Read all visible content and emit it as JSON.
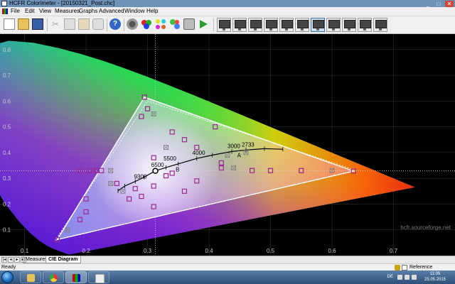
{
  "window": {
    "title": "HCFR Colorimeter - [20150321_Post.chc]",
    "controls": [
      "_",
      "□",
      "✕"
    ]
  },
  "menu": {
    "items": [
      "File",
      "Edit",
      "View",
      "Measures",
      "Graphs",
      "Advanced",
      "Window",
      "Help"
    ]
  },
  "toolbar": {
    "icons": [
      "new-icon",
      "open-icon",
      "save-icon",
      "cut-icon",
      "copy-icon",
      "paste-icon",
      "print-icon",
      "help-icon",
      "probe-icon",
      "rgb-icon",
      "measure-colors-icon",
      "calibration-icon",
      "camera-icon",
      "play-icon"
    ],
    "view_buttons": 11,
    "active_view_index": 6
  },
  "chart_data": {
    "type": "scatter",
    "title": "",
    "watermark": "hcfr.sourceforge.net",
    "xlim": [
      0.06,
      0.8
    ],
    "ylim": [
      0.0,
      0.86
    ],
    "x_ticks": [
      "0.1",
      "0.2",
      "0.3",
      "0.4",
      "0.5",
      "0.6",
      "0.7"
    ],
    "y_ticks": [
      "0.1",
      "0.2",
      "0.3",
      "0.4",
      "0.5",
      "0.6",
      "0.7",
      "0.8"
    ],
    "x_tick_values": [
      0.1,
      0.2,
      0.3,
      0.4,
      0.5,
      0.6,
      0.7
    ],
    "y_tick_values": [
      0.1,
      0.2,
      0.3,
      0.4,
      0.5,
      0.6,
      0.7,
      0.8
    ],
    "gamut_reference": [
      [
        0.64,
        0.33
      ],
      [
        0.3,
        0.6
      ],
      [
        0.15,
        0.06
      ]
    ],
    "gamut_measured": [
      [
        0.635,
        0.328
      ],
      [
        0.295,
        0.615
      ],
      [
        0.153,
        0.062
      ]
    ],
    "white_point": [
      0.3127,
      0.329
    ],
    "planckian_locus": [
      [
        0.252,
        0.252
      ],
      [
        0.263,
        0.27
      ],
      [
        0.28,
        0.288
      ],
      [
        0.294,
        0.304
      ],
      [
        0.3127,
        0.329
      ],
      [
        0.33,
        0.342
      ],
      [
        0.35,
        0.356
      ],
      [
        0.38,
        0.377
      ],
      [
        0.405,
        0.39
      ],
      [
        0.437,
        0.404
      ],
      [
        0.46,
        0.41
      ],
      [
        0.49,
        0.415
      ],
      [
        0.52,
        0.413
      ]
    ],
    "cct_labels": [
      {
        "text": "9300",
        "x": 0.285,
        "y": 0.285
      },
      {
        "text": "6500",
        "x": 0.313,
        "y": 0.331
      },
      {
        "text": "5500",
        "x": 0.333,
        "y": 0.355
      },
      {
        "text": "4000",
        "x": 0.38,
        "y": 0.377
      },
      {
        "text": "3000",
        "x": 0.437,
        "y": 0.404
      },
      {
        "text": "2733",
        "x": 0.46,
        "y": 0.41
      }
    ],
    "illuminant_labels": [
      {
        "text": "A",
        "x": 0.448,
        "y": 0.407
      },
      {
        "text": "B",
        "x": 0.348,
        "y": 0.352
      }
    ],
    "measured_points": [
      [
        0.635,
        0.328
      ],
      [
        0.295,
        0.615
      ],
      [
        0.153,
        0.062
      ],
      [
        0.225,
        0.33
      ],
      [
        0.19,
        0.33
      ],
      [
        0.206,
        0.33
      ],
      [
        0.217,
        0.33
      ],
      [
        0.41,
        0.5
      ],
      [
        0.3,
        0.57
      ],
      [
        0.29,
        0.54
      ],
      [
        0.36,
        0.45
      ],
      [
        0.38,
        0.42
      ],
      [
        0.55,
        0.33
      ],
      [
        0.5,
        0.33
      ],
      [
        0.47,
        0.33
      ],
      [
        0.2,
        0.22
      ],
      [
        0.2,
        0.17
      ],
      [
        0.19,
        0.14
      ],
      [
        0.31,
        0.38
      ],
      [
        0.31,
        0.27
      ],
      [
        0.31,
        0.19
      ],
      [
        0.29,
        0.23
      ],
      [
        0.28,
        0.26
      ],
      [
        0.34,
        0.48
      ],
      [
        0.42,
        0.34
      ],
      [
        0.38,
        0.29
      ],
      [
        0.36,
        0.25
      ],
      [
        0.33,
        0.31
      ],
      [
        0.34,
        0.32
      ],
      [
        0.42,
        0.36
      ],
      [
        0.25,
        0.28
      ],
      [
        0.27,
        0.22
      ]
    ],
    "reference_points": [
      [
        0.6,
        0.33
      ],
      [
        0.31,
        0.55
      ],
      [
        0.17,
        0.1
      ],
      [
        0.24,
        0.33
      ],
      [
        0.46,
        0.4
      ],
      [
        0.43,
        0.39
      ],
      [
        0.26,
        0.25
      ],
      [
        0.24,
        0.28
      ],
      [
        0.33,
        0.42
      ],
      [
        0.44,
        0.34
      ]
    ],
    "colors": {
      "background": "#000000",
      "axis_label": "#c8c8c8",
      "grid": "#3a3a3a",
      "triangle": "#ffffff",
      "measured": "#9b2a8c",
      "reference": "#808080",
      "locus": "#000000"
    }
  },
  "tabs": {
    "items": [
      "Measures",
      "CIE Diagram"
    ],
    "active": "CIE Diagram"
  },
  "status": {
    "text": "Ready",
    "reference_label": "Reference"
  },
  "taskbar": {
    "apps": [
      "explorer-app",
      "chrome-app",
      "hcfr-app",
      "paint-app"
    ],
    "language": "DE",
    "time": "11:05",
    "date": "25.05.2015"
  }
}
